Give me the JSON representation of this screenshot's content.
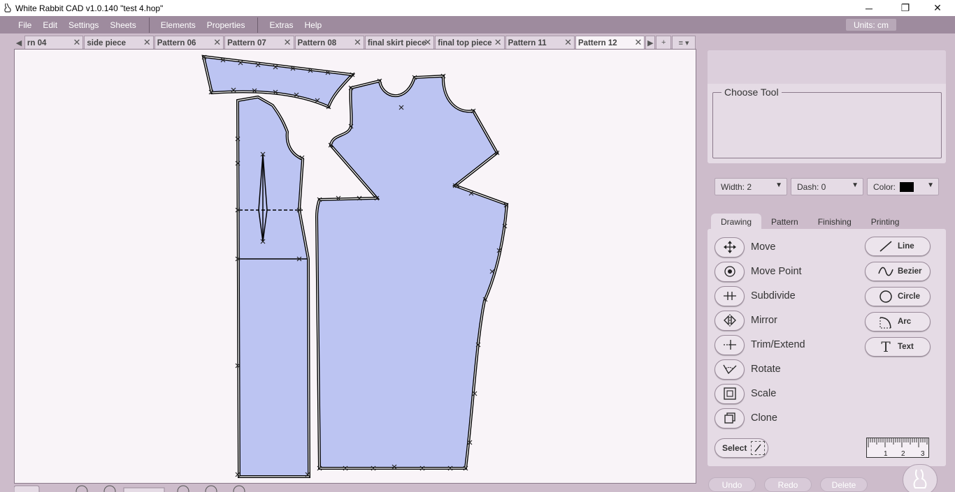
{
  "window": {
    "title": "White Rabbit CAD v1.0.140  \"test 4.hop\"",
    "minimize": "─",
    "maximize": "❐",
    "close": "✕"
  },
  "menu": {
    "file": "File",
    "edit": "Edit",
    "settings": "Settings",
    "sheets": "Sheets",
    "elements": "Elements",
    "properties": "Properties",
    "extras": "Extras",
    "help": "Help"
  },
  "units": "Units:  cm",
  "tabs": [
    {
      "label": "rn 04"
    },
    {
      "label": "side piece"
    },
    {
      "label": "Pattern 06"
    },
    {
      "label": "Pattern 07"
    },
    {
      "label": "Pattern 08"
    },
    {
      "label": "final skirt piece"
    },
    {
      "label": "final top piece"
    },
    {
      "label": "Pattern 11"
    },
    {
      "label": "Pattern 12",
      "active": true
    }
  ],
  "tab_close": "✕",
  "tab_controls": {
    "add": "+",
    "menu": "≡ ▾"
  },
  "choose_tool": "Choose Tool",
  "width": "Width:  2",
  "dash": "Dash:  0",
  "color": {
    "label": "Color:",
    "value": "#000000"
  },
  "tool_tabs": {
    "drawing": "Drawing",
    "pattern": "Pattern",
    "finishing": "Finishing",
    "printing": "Printing"
  },
  "tools": {
    "move": "Move",
    "move_point": "Move Point",
    "subdivide": "Subdivide",
    "mirror": "Mirror",
    "trim_extend": "Trim/Extend",
    "rotate": "Rotate",
    "scale": "Scale",
    "clone": "Clone"
  },
  "shapes": {
    "line": "Line",
    "bezier": "Bezier",
    "circle": "Circle",
    "arc": "Arc",
    "text": "Text"
  },
  "select": "Select",
  "ruler_ticks": [
    "1",
    "2",
    "3"
  ],
  "actions": {
    "undo": "Undo",
    "redo": "Redo",
    "delete": "Delete"
  },
  "colors": {
    "pattern_fill": "#bcc4f2",
    "canvas": "#f9f4f8",
    "menu_bar": "#9e8b9e"
  }
}
